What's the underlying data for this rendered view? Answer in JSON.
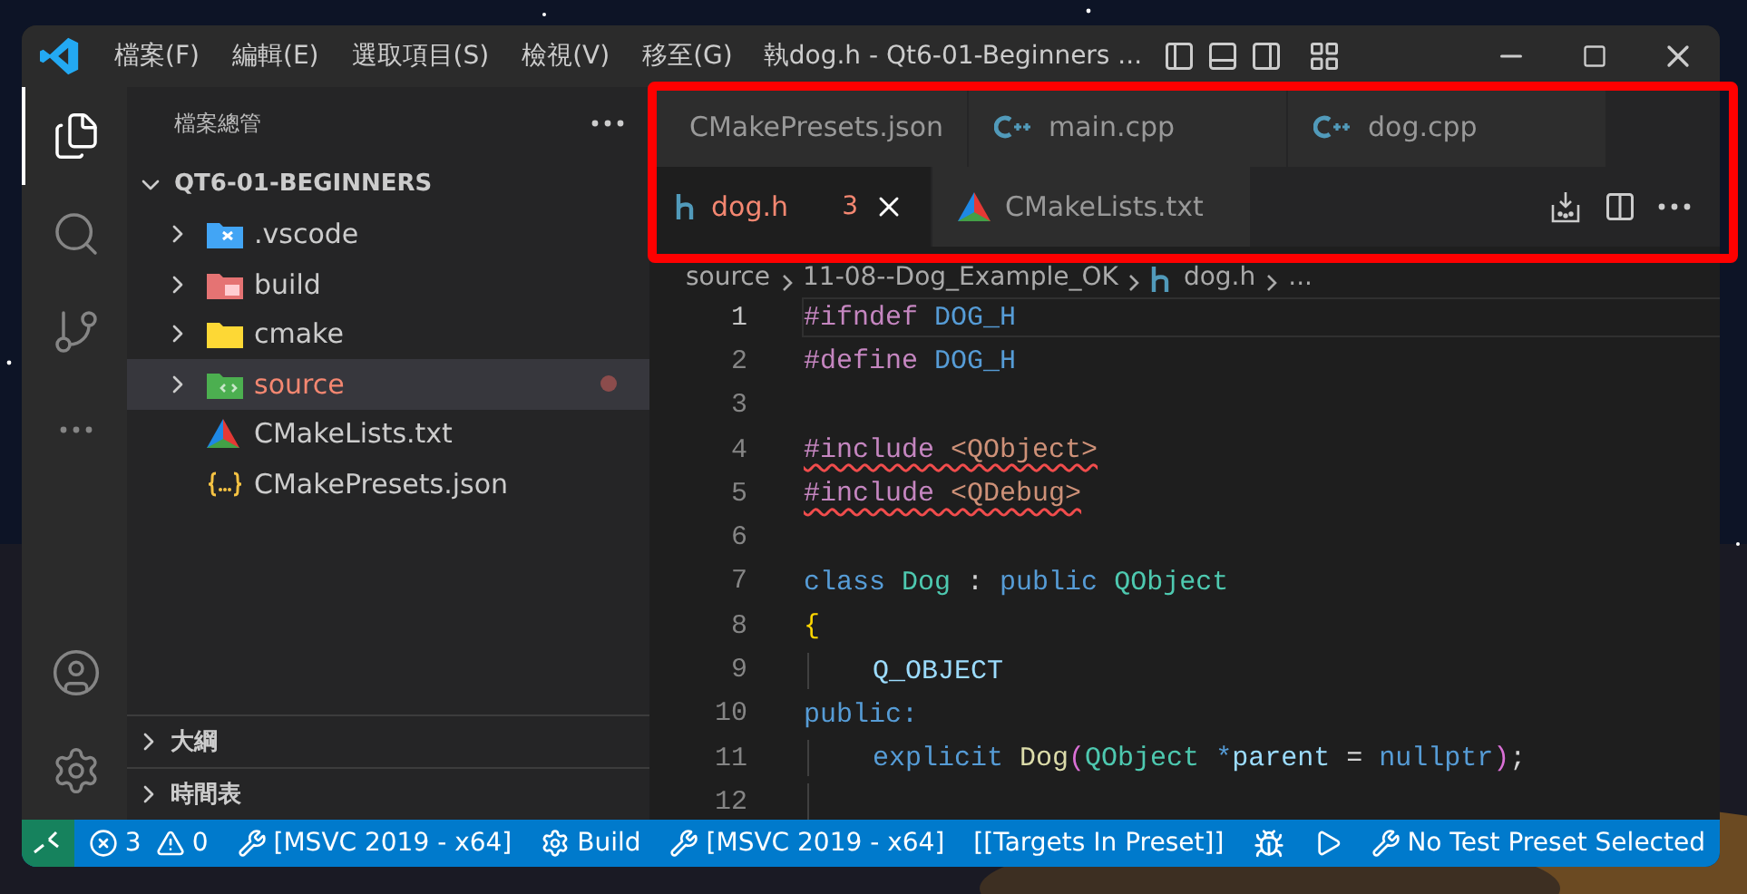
{
  "title_bar": {
    "menus": [
      "檔案(F)",
      "編輯(E)",
      "選取項目(S)",
      "檢視(V)",
      "移至(G)"
    ],
    "title": "執dog.h - Qt6-01-Beginners ..."
  },
  "activity_bar": [
    {
      "kind": "files",
      "selected": true
    },
    {
      "kind": "search",
      "selected": false
    },
    {
      "kind": "scm",
      "selected": false
    },
    {
      "kind": "more",
      "selected": false
    }
  ],
  "activity_bottom": [
    {
      "kind": "account"
    },
    {
      "kind": "settings"
    }
  ],
  "sidebar": {
    "title": "檔案總管",
    "root": {
      "label": "QT6-01-BEGINNERS",
      "expanded": true
    },
    "items": [
      {
        "label": ".vscode",
        "kind": "vscode-folder",
        "selected": false,
        "modified": false
      },
      {
        "label": "build",
        "kind": "build-folder",
        "selected": false,
        "modified": false
      },
      {
        "label": "cmake",
        "kind": "folder",
        "selected": false,
        "modified": false
      },
      {
        "label": "source",
        "kind": "source-folder",
        "selected": true,
        "modified": true
      },
      {
        "label": "CMakeLists.txt",
        "kind": "cmake-file",
        "selected": false,
        "modified": false
      },
      {
        "label": "CMakePresets.json",
        "kind": "json-file",
        "selected": false,
        "modified": false
      }
    ],
    "panels": [
      {
        "label": "大綱",
        "expanded": false
      },
      {
        "label": "時間表",
        "expanded": false
      }
    ]
  },
  "tab_rows": [
    [
      {
        "label": "CMakePresets.json",
        "kind": "json",
        "selected": false,
        "error_state": false
      },
      {
        "label": "main.cpp",
        "kind": "cpp",
        "selected": false,
        "error_state": false
      },
      {
        "label": "dog.cpp",
        "kind": "cpp",
        "selected": false,
        "error_state": false
      }
    ],
    [
      {
        "label": "dog.h",
        "kind": "h",
        "selected": true,
        "errors": "3",
        "error_state": true
      },
      {
        "label": "CMakeLists.txt",
        "kind": "cmake",
        "selected": false,
        "error_state": false
      }
    ]
  ],
  "breadcrumb": [
    "source",
    "11-08--Dog_Example_OK",
    "dog.h",
    "..."
  ],
  "code": [
    {
      "number": "1",
      "current": true,
      "tokens": [
        {
          "text": "#ifndef",
          "kind": "preproc"
        },
        {
          "text": " DOG_H",
          "kind": "macro"
        }
      ]
    },
    {
      "number": "2",
      "current": false,
      "tokens": [
        {
          "text": "#define",
          "kind": "preproc"
        },
        {
          "text": " DOG_H",
          "kind": "macro"
        }
      ]
    },
    {
      "number": "3",
      "current": false
    },
    {
      "number": "4",
      "current": false,
      "error": true,
      "tokens": [
        {
          "text": "#include",
          "kind": "preproc"
        },
        {
          "text": " <QObject>",
          "kind": "string"
        }
      ]
    },
    {
      "number": "5",
      "current": false,
      "error": true,
      "tokens": [
        {
          "text": "#include",
          "kind": "preproc"
        },
        {
          "text": " <QDebug>",
          "kind": "string"
        }
      ]
    },
    {
      "number": "6",
      "current": false
    },
    {
      "number": "7",
      "current": false,
      "tokens": [
        {
          "text": "class",
          "kind": "keyword"
        },
        {
          "text": " Dog",
          "kind": "type"
        },
        {
          "text": " : ",
          "kind": "plain"
        },
        {
          "text": "public",
          "kind": "keyword"
        },
        {
          "text": " QObject",
          "kind": "type"
        }
      ]
    },
    {
      "number": "8",
      "current": false,
      "tokens": [
        {
          "text": "{",
          "kind": "brace"
        }
      ]
    },
    {
      "number": "9",
      "current": false,
      "guide": true,
      "tokens": [
        {
          "text": "Q_OBJECT",
          "kind": "var"
        }
      ]
    },
    {
      "number": "10",
      "current": false,
      "tokens": [
        {
          "text": "public:",
          "kind": "keyword"
        }
      ]
    },
    {
      "number": "11",
      "current": false,
      "guide": true,
      "tokens": [
        {
          "text": "explicit",
          "kind": "keyword"
        },
        {
          "text": " Dog",
          "kind": "func"
        },
        {
          "text": "(",
          "kind": "paren"
        },
        {
          "text": "QObject",
          "kind": "type"
        },
        {
          "text": " *",
          "kind": "keyword"
        },
        {
          "text": "parent",
          "kind": "var"
        },
        {
          "text": " = ",
          "kind": "plain"
        },
        {
          "text": "nullptr",
          "kind": "keyword"
        },
        {
          "text": ")",
          "kind": "paren"
        },
        {
          "text": ";",
          "kind": "plain"
        }
      ]
    },
    {
      "number": "12",
      "current": false,
      "guide": true
    }
  ],
  "status_bar": [
    {
      "kind": "errors",
      "text": "3"
    },
    {
      "kind": "warnings",
      "text": "0"
    },
    {
      "kind": "tools",
      "text": "[MSVC 2019 - x64]"
    },
    {
      "kind": "gear",
      "text": "Build"
    },
    {
      "kind": "tools",
      "text": "[MSVC 2019 - x64]"
    },
    {
      "kind": "plain",
      "text": "[[Targets In Preset]]"
    },
    {
      "kind": "bug"
    },
    {
      "kind": "play"
    },
    {
      "kind": "tools",
      "text": "No Test Preset Selected"
    }
  ]
}
